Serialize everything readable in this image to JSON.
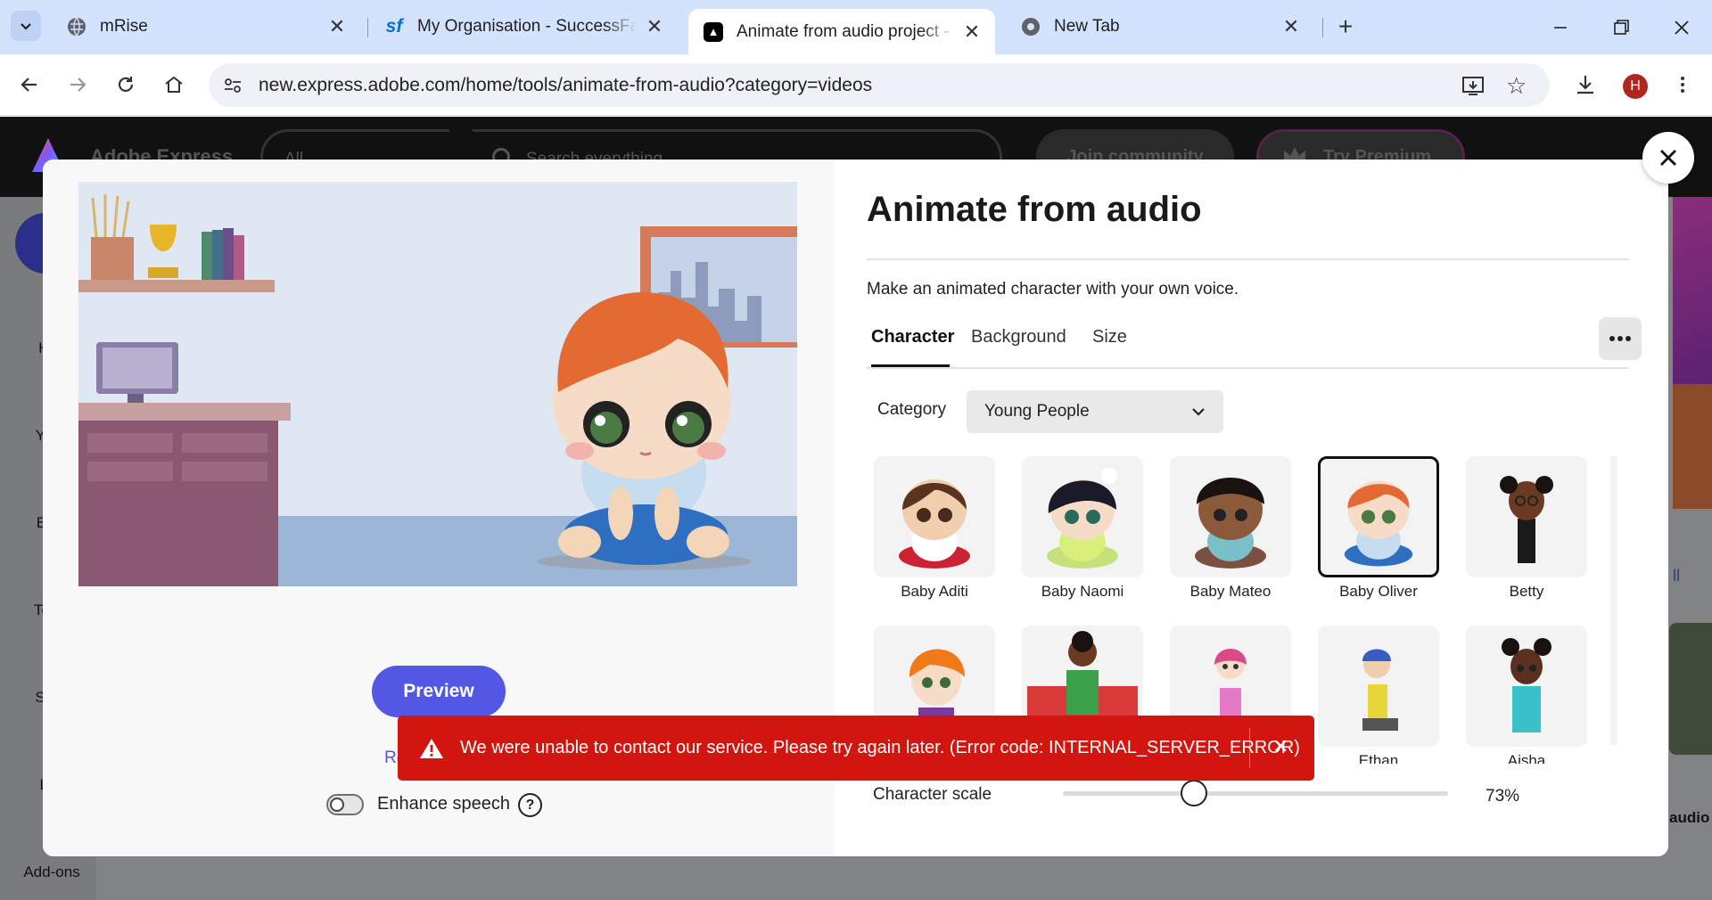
{
  "browser": {
    "tabs": [
      {
        "title": "mRise",
        "icon": "globe-icon"
      },
      {
        "title": "My Organisation - SuccessFacto",
        "icon": "sf-logo-icon"
      },
      {
        "title": "Animate from audio project - Ju",
        "icon": "adobe-express-logo-icon"
      },
      {
        "title": "New Tab",
        "icon": "chrome-icon"
      }
    ],
    "url": "new.express.adobe.com/home/tools/animate-from-audio?category=videos",
    "profile_initial": "H"
  },
  "app": {
    "name": "Adobe Express",
    "search_scope": "All",
    "search_placeholder": "Search everything",
    "join_label": "Join community",
    "premium_label": "Try Premium",
    "sidebar": [
      "Ho",
      "You",
      "Bra",
      "Tem",
      "Sch",
      "Le",
      "Add-ons"
    ],
    "right_peek_label": "audio",
    "right_peek_link": "ll"
  },
  "modal": {
    "title": "Animate from audio",
    "subtitle": "Make an animated character with your own voice.",
    "tabs": [
      "Character",
      "Background",
      "Size"
    ],
    "active_tab": "Character",
    "category_label": "Category",
    "category_value": "Young People",
    "characters_row1": [
      "Baby Aditi",
      "Baby Naomi",
      "Baby Mateo",
      "Baby Oliver",
      "Betty"
    ],
    "characters_row2": [
      "",
      "",
      "",
      "Ethan",
      "Aisha"
    ],
    "selected_character": "Baby Oliver",
    "scale_label": "Character scale",
    "scale_value": "73%",
    "scale_fraction": 0.34,
    "preview_label": "Preview",
    "record_partial": "Re",
    "enhance_label": "Enhance speech",
    "enhance_on": false
  },
  "toast": {
    "message": "We were unable to contact our service. Please try again later. (Error code: INTERNAL_SERVER_ERROR)",
    "color": "#d31510"
  },
  "colors": {
    "accent": "#5258e4",
    "tabbar": "#d3e3fd"
  }
}
